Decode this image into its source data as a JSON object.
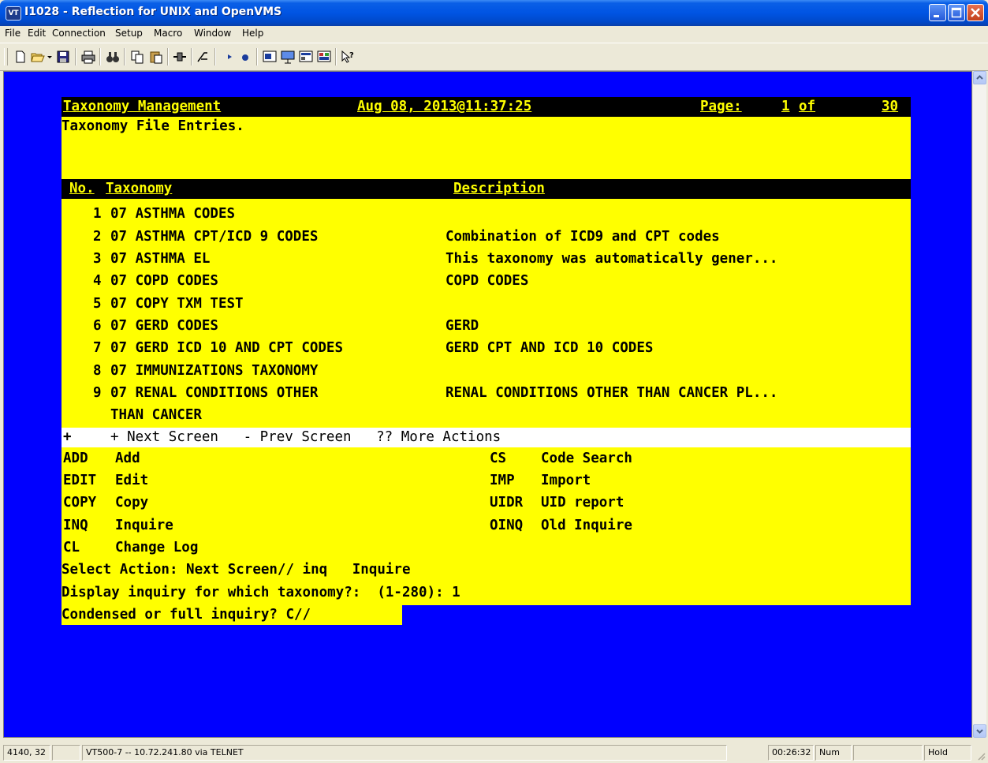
{
  "window": {
    "title": "I1028 - Reflection for UNIX and OpenVMS",
    "app_icon_text": "VT"
  },
  "menu": [
    {
      "label": "File"
    },
    {
      "label": "Edit"
    },
    {
      "label": "Connection"
    },
    {
      "label": "Setup"
    },
    {
      "label": "Macro"
    },
    {
      "label": "Window"
    },
    {
      "label": "Help"
    }
  ],
  "toolbar_icons": [
    "new-document-icon",
    "open-folder-icon",
    "save-icon",
    "print-icon",
    "find-icon",
    "copy-icon",
    "paste-icon",
    "connect-icon",
    "disconnect-icon",
    "play-macro-icon",
    "record-macro-icon",
    "setup-1-icon",
    "setup-2-icon",
    "setup-3-icon",
    "setup-4-icon",
    "context-help-icon"
  ],
  "terminal": {
    "header": {
      "left": "Taxonomy Management",
      "date": "Aug 08, 2013@11:37:25",
      "page_label": "Page:",
      "page_current": "1",
      "page_of": "of",
      "page_total": "30"
    },
    "subtitle": "Taxonomy File Entries.",
    "columns": {
      "no": "No.",
      "taxonomy": "Taxonomy",
      "description": "Description"
    },
    "entries": [
      {
        "no": "1",
        "taxonomy": "07 ASTHMA CODES",
        "description": ""
      },
      {
        "no": "2",
        "taxonomy": "07 ASTHMA CPT/ICD 9 CODES",
        "description": "Combination of ICD9 and CPT codes"
      },
      {
        "no": "3",
        "taxonomy": "07 ASTHMA EL",
        "description": "This taxonomy was automatically gener..."
      },
      {
        "no": "4",
        "taxonomy": "07 COPD CODES",
        "description": "COPD CODES"
      },
      {
        "no": "5",
        "taxonomy": "07 COPY TXM TEST",
        "description": ""
      },
      {
        "no": "6",
        "taxonomy": "07 GERD CODES",
        "description": "GERD"
      },
      {
        "no": "7",
        "taxonomy": "07 GERD ICD 10 AND CPT CODES",
        "description": "GERD CPT AND ICD 10 CODES"
      },
      {
        "no": "8",
        "taxonomy": "07 IMMUNIZATIONS TAXONOMY",
        "description": ""
      },
      {
        "no": "9",
        "taxonomy": "07 RENAL CONDITIONS OTHER",
        "description": "RENAL CONDITIONS OTHER THAN CANCER PL..."
      },
      {
        "no": "",
        "taxonomy": "THAN CANCER",
        "description": ""
      }
    ],
    "nav_bar": {
      "marker": "+",
      "text": "+ Next Screen   - Prev Screen   ?? More Actions"
    },
    "actions_left": [
      {
        "code": "ADD",
        "label": "Add"
      },
      {
        "code": "EDIT",
        "label": "Edit"
      },
      {
        "code": "COPY",
        "label": "Copy"
      },
      {
        "code": "INQ",
        "label": "Inquire"
      },
      {
        "code": "CL",
        "label": "Change Log"
      }
    ],
    "actions_right": [
      {
        "code": "CS",
        "label": "Code Search"
      },
      {
        "code": "IMP",
        "label": "Import"
      },
      {
        "code": "UIDR",
        "label": "UID report"
      },
      {
        "code": "OINQ",
        "label": "Old Inquire"
      }
    ],
    "prompts": [
      "Select Action: Next Screen// inq   Inquire",
      "Display inquiry for which taxonomy?:  (1-280): 1",
      "Condensed or full inquiry? C//"
    ]
  },
  "statusbar": {
    "cursor_pos": "4140, 32",
    "blank1": "",
    "connection": "VT500-7 -- 10.72.241.80 via TELNET",
    "time": "00:26:32",
    "num": "Num",
    "blank2": "",
    "hold": "Hold"
  }
}
